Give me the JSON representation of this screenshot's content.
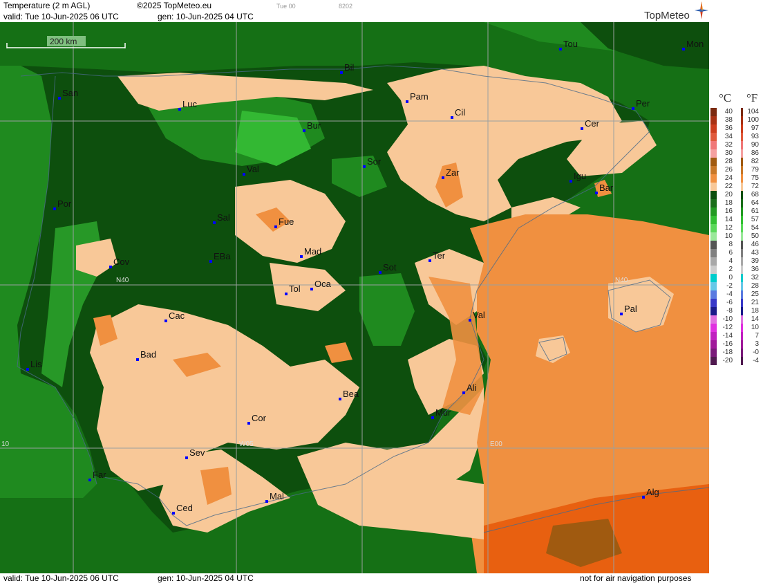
{
  "header": {
    "title": "Temperature (2 m AGL)",
    "copyright": "©2025 TopMeteo.eu",
    "run_tag": "Tue 00",
    "code": "8202",
    "valid": "valid:  Tue  10-Jun-2025  06 UTC",
    "gen": "gen: 10-Jun-2025 04 UTC",
    "brand": "TopMeteo"
  },
  "footer": {
    "valid": "valid:  Tue  10-Jun-2025  06 UTC",
    "gen": "gen: 10-Jun-2025 04 UTC",
    "notice": "not for air navigation purposes"
  },
  "scale_bar": {
    "label": "200 km"
  },
  "grid_labels": {
    "n40_west": "N40",
    "n40_east": "N40",
    "w05": "W05",
    "e00": "E00",
    "w10": "10"
  },
  "cities": [
    {
      "name": "Tou"
    },
    {
      "name": "Mon"
    },
    {
      "name": "Bil"
    },
    {
      "name": "San"
    },
    {
      "name": "Pam"
    },
    {
      "name": "Per"
    },
    {
      "name": "Luc"
    },
    {
      "name": "Cil"
    },
    {
      "name": "Bur"
    },
    {
      "name": "Cer"
    },
    {
      "name": "Sor"
    },
    {
      "name": "Val"
    },
    {
      "name": "Zar"
    },
    {
      "name": "Igu"
    },
    {
      "name": "Bar"
    },
    {
      "name": "Por"
    },
    {
      "name": "Sal"
    },
    {
      "name": "Fue"
    },
    {
      "name": "Mad"
    },
    {
      "name": "Cov"
    },
    {
      "name": "EBa"
    },
    {
      "name": "Sot"
    },
    {
      "name": "Ter"
    },
    {
      "name": "Tol"
    },
    {
      "name": "Oca"
    },
    {
      "name": "Val"
    },
    {
      "name": "Pal"
    },
    {
      "name": "Cac"
    },
    {
      "name": "Bad"
    },
    {
      "name": "Lis"
    },
    {
      "name": "Ali"
    },
    {
      "name": "Bea"
    },
    {
      "name": "Mur"
    },
    {
      "name": "Cor"
    },
    {
      "name": "Sev"
    },
    {
      "name": "Far"
    },
    {
      "name": "Mal"
    },
    {
      "name": "Alg"
    },
    {
      "name": "Ced"
    }
  ],
  "legend": {
    "celsius_unit": "°C",
    "fahrenheit_unit": "°F",
    "celsius": [
      "40",
      "38",
      "36",
      "34",
      "32",
      "30",
      "28",
      "26",
      "24",
      "22",
      "20",
      "18",
      "16",
      "14",
      "12",
      "10",
      "8",
      "6",
      "4",
      "2",
      "0",
      "-2",
      "-4",
      "-6",
      "-8",
      "-10",
      "-12",
      "-14",
      "-16",
      "-18",
      "-20"
    ],
    "fahrenheit": [
      "104",
      "100",
      "97",
      "93",
      "90",
      "86",
      "82",
      "79",
      "75",
      "72",
      "68",
      "64",
      "61",
      "57",
      "54",
      "50",
      "46",
      "43",
      "39",
      "36",
      "32",
      "28",
      "25",
      "21",
      "18",
      "14",
      "10",
      "7",
      "3",
      "-0",
      "-4"
    ],
    "colors": [
      "#7b2a10",
      "#a83214",
      "#cc3e1e",
      "#e05a3c",
      "#f07878",
      "#f5a0a0",
      "#a05a10",
      "#c87828",
      "#f09040",
      "#f8c898",
      "#0d4f0d",
      "#1a6e1a",
      "#229a22",
      "#33c033",
      "#5ad85a",
      "#9ae89a",
      "#555555",
      "#808080",
      "#a8a8a8",
      "#cccccc",
      "#00cccc",
      "#66c8e8",
      "#5a7ae0",
      "#3838c8",
      "#1a1a8a",
      "#e070e0",
      "#e030e0",
      "#c020c0",
      "#a01a9a",
      "#7a1a7a",
      "#501a50"
    ]
  },
  "map_colors": {
    "sea_green": "#157015",
    "dark_green": "#0d4f0d",
    "mid_green": "#1f8a1f",
    "bright_green": "#33b833",
    "peach": "#f8c898",
    "orange": "#f09040",
    "dark_orange": "#e86010",
    "brown": "#a05a10",
    "grid": "#9aa0a0",
    "border": "#4a6a8a",
    "city_marker": "#0000ff"
  }
}
